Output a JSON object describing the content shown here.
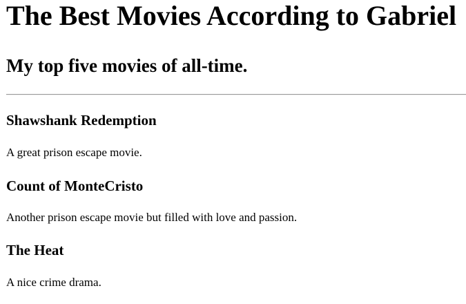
{
  "page": {
    "title": "The Best Movies According to Gabriel",
    "subtitle": "My top five movies of all-time."
  },
  "movies": [
    {
      "title": "Shawshank Redemption",
      "description": "A great prison escape movie."
    },
    {
      "title": "Count of MonteCristo",
      "description": "Another prison escape movie but filled with love and passion."
    },
    {
      "title": "The Heat",
      "description": "A nice crime drama."
    }
  ]
}
